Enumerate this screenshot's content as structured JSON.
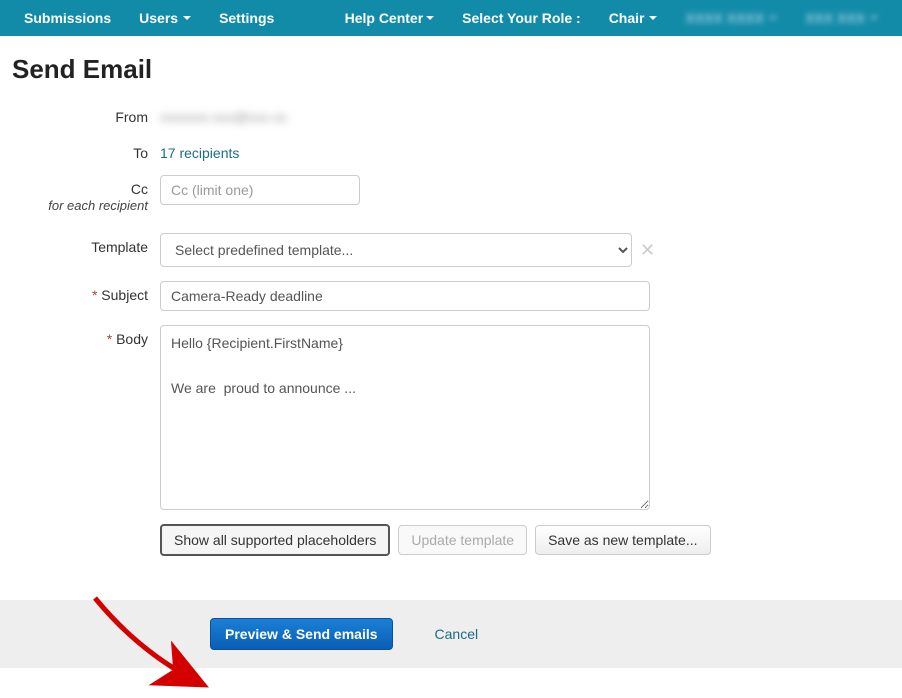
{
  "nav": {
    "submissions": "Submissions",
    "users": "Users",
    "settings": "Settings",
    "help": "Help Center",
    "role_label": "Select Your Role :",
    "role": "Chair",
    "blurred1": "XXXX XXXX",
    "blurred2": "XXX XXX"
  },
  "page": {
    "title": "Send Email"
  },
  "form": {
    "from_label": "From",
    "from_value": "xxxxxxx.xxx@xxx.xx",
    "to_label": "To",
    "to_value": "17 recipients",
    "cc_label": "Cc",
    "cc_sub": "for each recipient",
    "cc_placeholder": "Cc (limit one)",
    "template_label": "Template",
    "template_placeholder": "Select predefined template...",
    "subject_label": "Subject",
    "subject_value": "Camera-Ready deadline",
    "body_label": "Body",
    "body_value": "Hello {Recipient.FirstName}\n\nWe are  proud to announce ..."
  },
  "buttons": {
    "show_placeholders": "Show all supported placeholders",
    "update_template": "Update template",
    "save_template": "Save as new template...",
    "preview_send": "Preview & Send emails",
    "cancel": "Cancel"
  }
}
